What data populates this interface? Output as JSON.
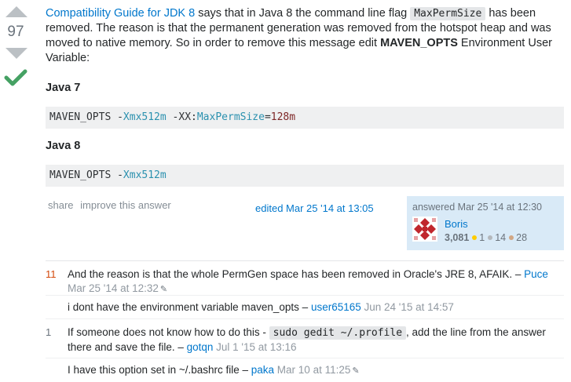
{
  "vote": {
    "count": "97"
  },
  "answer": {
    "intro_link": "Compatibility Guide for JDK 8",
    "intro_text_1": " says that in Java 8 the command line flag ",
    "intro_code": "MaxPermSize",
    "intro_text_2": " has been removed. The reason is that the permanent generation was removed from the hotspot heap and was moved to native memory. So in order to remove this message edit ",
    "intro_bold": "MAVEN_OPTS",
    "intro_text_3": " Environment User Variable:",
    "java7_heading": "Java 7",
    "java7_code": {
      "a": "MAVEN_OPTS -",
      "b": "Xmx512m",
      "c": " -XX:",
      "d": "MaxPermSize",
      "e": "=",
      "f": "128m"
    },
    "java8_heading": "Java 8",
    "java8_code": {
      "a": "MAVEN_OPTS -",
      "b": "Xmx512m"
    }
  },
  "menu": {
    "share": "share",
    "improve": "improve this answer"
  },
  "edited": "edited Mar 25 '14 at 13:05",
  "user_card": {
    "answered": "answered Mar 25 '14 at 12:30",
    "name": "Boris",
    "rep": "3,081",
    "gold": "1",
    "silver": "14",
    "bronze": "28",
    "colors": {
      "gold": "#ffcc01",
      "silver": "#b4b8bc",
      "bronze": "#d1a684",
      "card": "#d9eaf7"
    }
  },
  "comments": [
    {
      "score": "11",
      "text": "And the reason is that the whole PermGen space has been removed in Oracle's JRE 8, AFAIK. – ",
      "user": "Puce",
      "date": " Mar 25 '14 at 12:32",
      "edited": true
    },
    {
      "score": "",
      "text": "i dont have the environment variable maven_opts – ",
      "user": "user65165",
      "date": " Jun 24 '15 at 14:57",
      "edited": false
    },
    {
      "score": "1",
      "text_1": "If someone does not know how to do this - ",
      "code": "sudo gedit ~/.profile",
      "text_2": ", add the line from the answer there and save the file. – ",
      "user": "gotqn",
      "date": " Jul 1 '15 at 13:16",
      "edited": false
    },
    {
      "score": "",
      "text": "I have this option set in ~/.bashrc file – ",
      "user": "paka",
      "date": " Mar 10 at 11:25",
      "edited": true
    }
  ]
}
